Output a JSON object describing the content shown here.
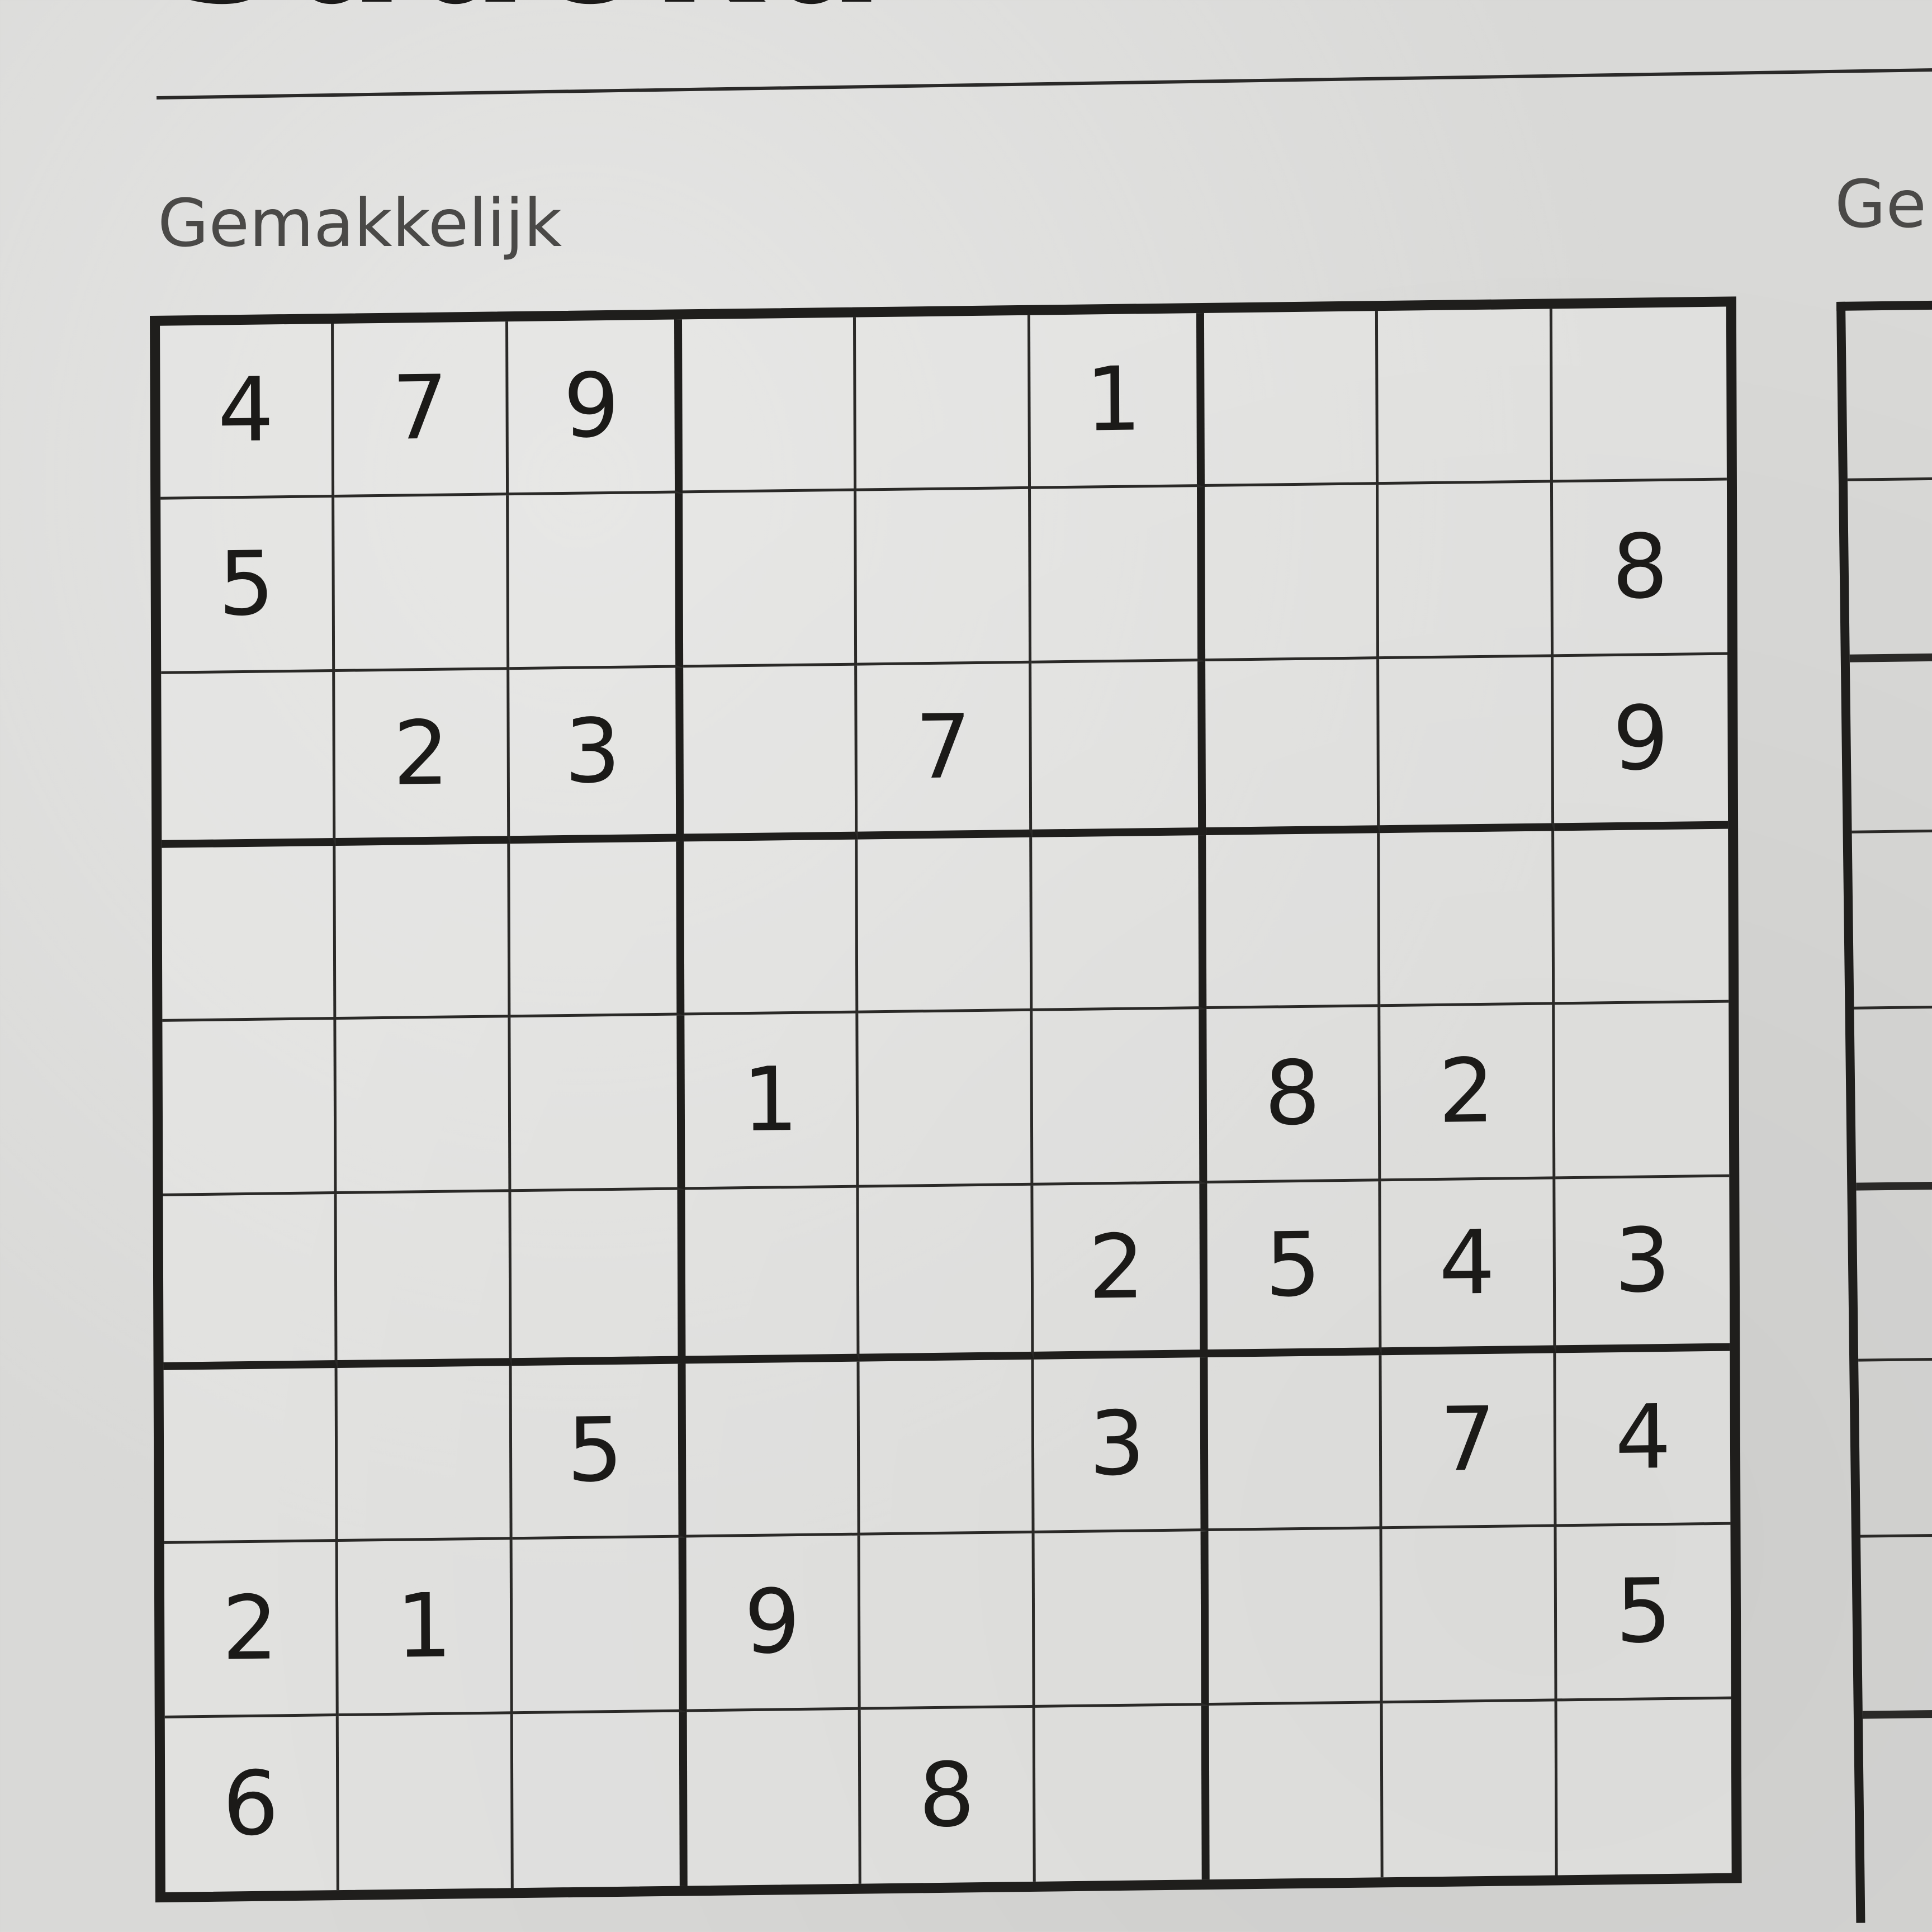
{
  "header": {
    "title": "Sudoku",
    "difficulty_left": "Gemakkelijk",
    "difficulty_right": "Ge"
  },
  "puzzle": {
    "rows": [
      [
        "4",
        "7",
        "9",
        "",
        "",
        "1",
        "",
        "",
        ""
      ],
      [
        "5",
        "",
        "",
        "",
        "",
        "",
        "",
        "",
        "8"
      ],
      [
        "",
        "2",
        "3",
        "",
        "7",
        "",
        "",
        "",
        "9"
      ],
      [
        "",
        "",
        "",
        "",
        "",
        "",
        "",
        "",
        ""
      ],
      [
        "",
        "",
        "",
        "1",
        "",
        "",
        "8",
        "2",
        ""
      ],
      [
        "",
        "",
        "",
        "",
        "",
        "2",
        "5",
        "4",
        "3"
      ],
      [
        "",
        "",
        "5",
        "",
        "",
        "3",
        "",
        "7",
        "4"
      ],
      [
        "2",
        "1",
        "",
        "9",
        "",
        "",
        "",
        "",
        "5"
      ],
      [
        "6",
        "",
        "",
        "",
        "8",
        "",
        "",
        "",
        ""
      ]
    ]
  }
}
